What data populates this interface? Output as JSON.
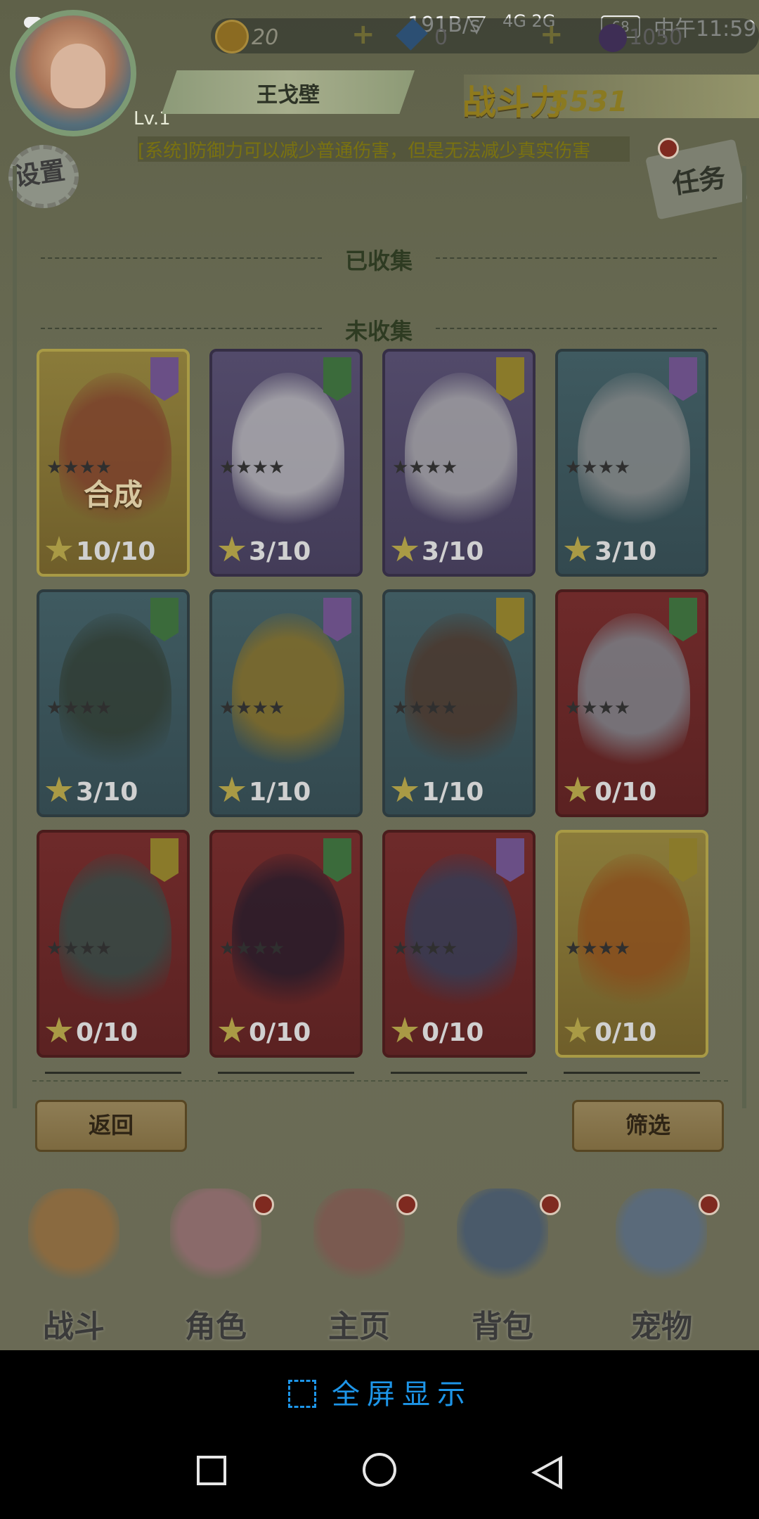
{
  "status_bar": {
    "net_speed": "191B/s",
    "signal": "4G 2G",
    "battery": "68",
    "time": "中午11:59"
  },
  "player": {
    "name": "王戈壁",
    "level": "Lv.1",
    "power_label": "战斗力",
    "power_value": "5531"
  },
  "resources": {
    "coins": "20",
    "gems": "0",
    "moons": "1050"
  },
  "ticker": "[系统]防御力可以减少普通伤害，但是无法减少真实伤害",
  "buttons": {
    "settings": "设置",
    "tasks": "任务",
    "back": "返回",
    "filter": "筛选",
    "fullscreen": "全屏显示"
  },
  "sections": {
    "collected": "已收集",
    "uncollected": "未收集"
  },
  "cards": [
    {
      "count": "10/10",
      "overlay": "合成",
      "frame": "gold",
      "art": "#7a3a2a",
      "badge": "#6a4f86"
    },
    {
      "count": "3/10",
      "frame": "purple",
      "art": "#b8b8b8",
      "badge": "#3b6b3b"
    },
    {
      "count": "3/10",
      "frame": "purple",
      "art": "#a8a8a8",
      "badge": "#8a7a2a"
    },
    {
      "count": "3/10",
      "frame": "teal",
      "art": "#8a8a8a",
      "badge": "#6a4f86"
    },
    {
      "count": "3/10",
      "frame": "teal",
      "art": "#2f3a2f",
      "badge": "#3b6b3b"
    },
    {
      "count": "1/10",
      "frame": "teal",
      "art": "#8a6f22",
      "badge": "#6a4f86"
    },
    {
      "count": "1/10",
      "frame": "teal",
      "art": "#4d3427",
      "badge": "#8a7a2a"
    },
    {
      "count": "0/10",
      "frame": "red",
      "art": "#7c8a92",
      "badge": "#3b6b3b"
    },
    {
      "count": "0/10",
      "frame": "red",
      "art": "#2e4f4a",
      "badge": "#8a7a2a"
    },
    {
      "count": "0/10",
      "frame": "red",
      "art": "#1f1a2a",
      "badge": "#3b6b3b"
    },
    {
      "count": "0/10",
      "frame": "red",
      "art": "#2f3f5a",
      "badge": "#6a4f86"
    },
    {
      "count": "0/10",
      "frame": "gold",
      "art": "#8a4a1a",
      "badge": "#8a7a2a"
    }
  ],
  "nav": [
    {
      "label": "战斗",
      "icon": "battle-icon",
      "color": "#8a6a40",
      "dot": false
    },
    {
      "label": "角色",
      "icon": "character-icon",
      "color": "#8a6a6a",
      "dot": true
    },
    {
      "label": "主页",
      "icon": "home-pagoda-icon",
      "color": "#7a5a50",
      "dot": true
    },
    {
      "label": "背包",
      "icon": "backpack-icon",
      "color": "#4a5a6a",
      "dot": true
    },
    {
      "label": "宠物",
      "icon": "pet-icon",
      "color": "#5a6a7a",
      "dot": true
    }
  ]
}
